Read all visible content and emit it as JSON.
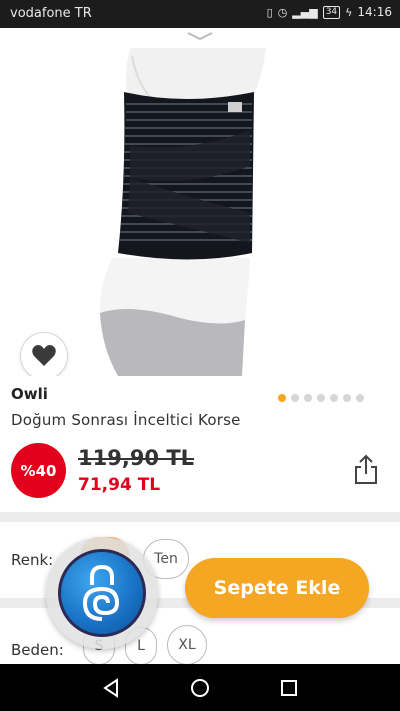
{
  "status_bar": {
    "carrier": "vodafone TR",
    "battery": "34",
    "time": "14:16",
    "icons": [
      "vibrate-icon",
      "alarm-icon",
      "signal-icon",
      "charging-icon"
    ]
  },
  "product": {
    "brand": "Owli",
    "title": "Doğum Sonrası İnceltici Korse",
    "discount": "%40",
    "old_price": "119,90 TL",
    "new_price": "71,94 TL",
    "image_count": 7,
    "active_image": 1
  },
  "options": {
    "color_label": "Renk:",
    "colors": [
      "Ten"
    ],
    "size_label": "Beden:",
    "sizes": [
      "S",
      "L",
      "XL"
    ]
  },
  "actions": {
    "add_to_cart": "Sepete Ekle"
  },
  "colors": {
    "accent": "#f5a623",
    "discount": "#e3001b",
    "status_bar": "#1c1c1c"
  }
}
